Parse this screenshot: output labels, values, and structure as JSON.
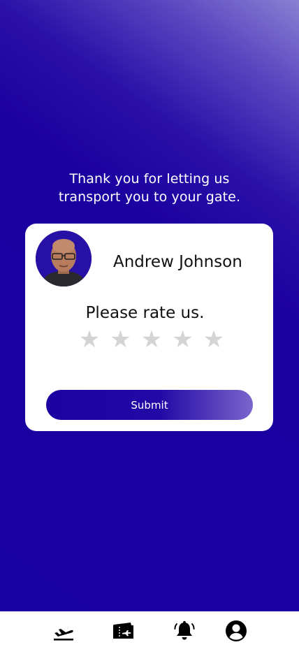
{
  "message": {
    "line1": "Thank you for letting us",
    "line2": "transport you to your gate."
  },
  "card": {
    "driver_name": "Andrew Johnson",
    "rate_prompt": "Please rate us.",
    "rating": {
      "current": 0,
      "max": 5,
      "star_glyph": "★"
    },
    "submit_label": "Submit"
  },
  "nav": {
    "items": [
      {
        "icon": "flight-departure-icon"
      },
      {
        "icon": "ticket-icon"
      },
      {
        "icon": "notification-bell-icon"
      },
      {
        "icon": "account-icon"
      }
    ]
  },
  "colors": {
    "primary": "#1900a0",
    "star_empty": "#d4d4d4",
    "card_bg": "#ffffff"
  }
}
